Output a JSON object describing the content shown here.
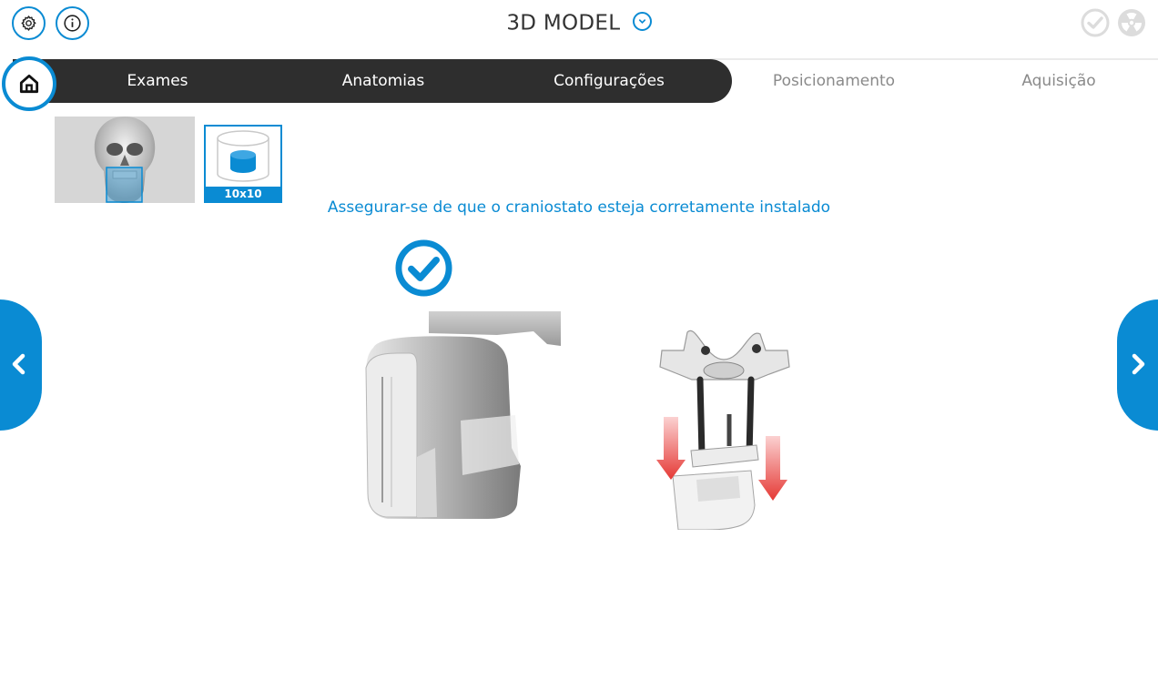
{
  "header": {
    "title": "3D MODEL",
    "icons": {
      "settings": "gear-icon",
      "info": "info-icon",
      "title_dropdown": "chevron-down-icon",
      "status_ready": "check-circle-icon",
      "status_radiation": "radiation-icon"
    }
  },
  "nav": {
    "home_icon": "home-icon",
    "tabs": [
      {
        "label": "Exames",
        "state": "completed"
      },
      {
        "label": "Anatomias",
        "state": "completed"
      },
      {
        "label": "Configurações",
        "state": "current"
      },
      {
        "label": "Posicionamento",
        "state": "pending"
      },
      {
        "label": "Aquisição",
        "state": "pending"
      }
    ]
  },
  "selection": {
    "anatomy_thumbnail": "skull-icon",
    "fov_label": "10x10"
  },
  "main": {
    "instruction": "Assegurar-se de que o craniostato esteja corretamente instalado",
    "confirm_icon": "check-circle-icon"
  },
  "colors": {
    "accent": "#0a8bd3",
    "nav_dark": "#2e2e2e",
    "arrow_red": "#e53935"
  }
}
